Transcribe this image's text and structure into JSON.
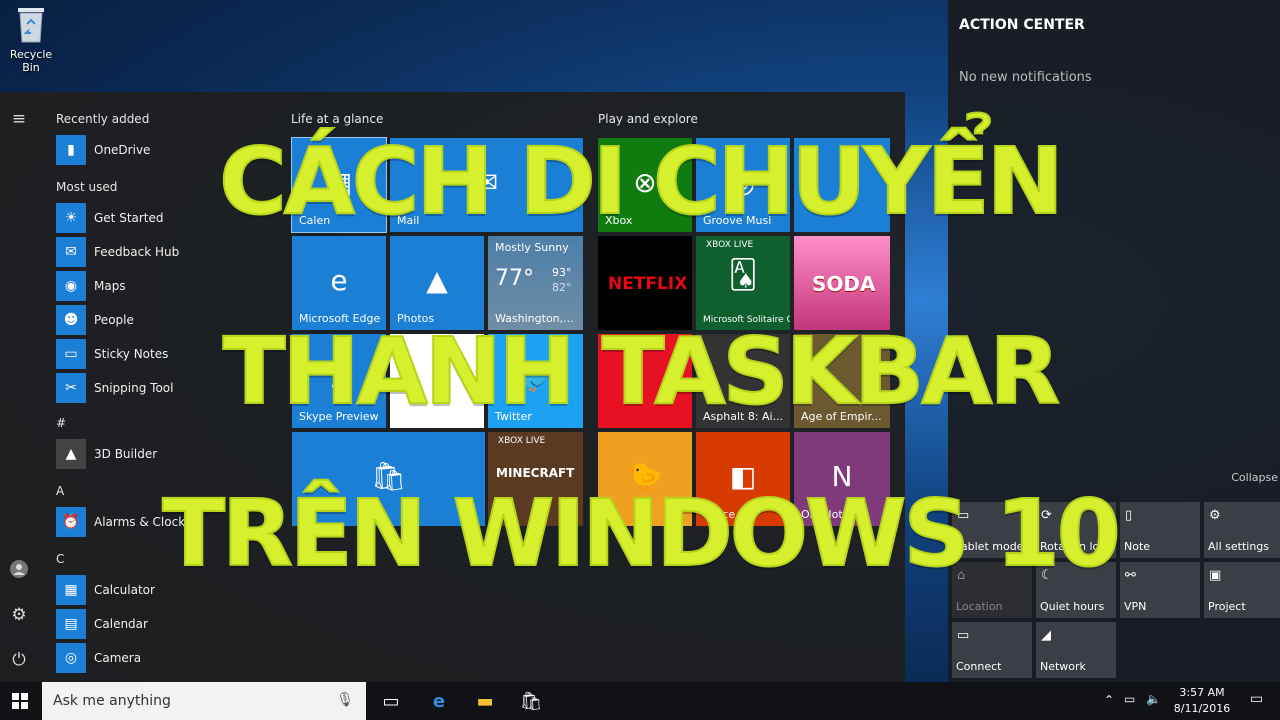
{
  "desktop": {
    "recycle_bin": "Recycle Bin"
  },
  "start_menu": {
    "sections": {
      "recently_added": "Recently added",
      "most_used": "Most used",
      "hash": "#",
      "a": "A",
      "c": "C"
    },
    "apps": {
      "onedrive": "OneDrive",
      "get_started": "Get Started",
      "feedback_hub": "Feedback Hub",
      "maps": "Maps",
      "people": "People",
      "sticky_notes": "Sticky Notes",
      "snipping_tool": "Snipping Tool",
      "builder": "3D Builder",
      "alarms": "Alarms & Clock",
      "calculator": "Calculator",
      "calendar": "Calendar",
      "camera": "Camera"
    },
    "groups": {
      "life": "Life at a glance",
      "play": "Play and explore"
    },
    "tiles": {
      "calendar": "Calen",
      "mail": "Mail",
      "xbox": "Xbox",
      "groove": "Groove Musi",
      "edge": "Microsoft Edge",
      "photos": "Photos",
      "weather_cond": "Mostly Sunny",
      "weather_temp": "77°",
      "weather_hi": "93°",
      "weather_lo": "82°",
      "weather_city": "Washington,...",
      "netflix": "NETFLIX",
      "solitaire": "Microsoft Solitaire Collection",
      "xbox_live": "XBOX LIVE",
      "candy": "SODA",
      "skype": "Skype Preview",
      "twitter": "Twitter",
      "asphalt": "Asphalt 8: Ai...",
      "aoe": "Age of Empir...",
      "minecraft": "MINECRAFT",
      "office": "Office",
      "onenote": "OneNote"
    }
  },
  "action_center": {
    "title": "ACTION CENTER",
    "empty": "No new notifications",
    "collapse": "Collapse",
    "quick_actions": {
      "tablet": "Tablet mode",
      "rotation": "Rotation lock",
      "note": "Note",
      "settings": "All settings",
      "location": "Location",
      "quiet": "Quiet hours",
      "vpn": "VPN",
      "project": "Project",
      "connect": "Connect",
      "network": "Network"
    }
  },
  "taskbar": {
    "search_placeholder": "Ask me anything",
    "time": "3:57 AM",
    "date": "8/11/2016"
  },
  "overlay": {
    "line1": "CÁCH DI CHUYỂN",
    "line2": "THANH TASKBAR",
    "line3": "TRÊN WINDOWS 10"
  }
}
